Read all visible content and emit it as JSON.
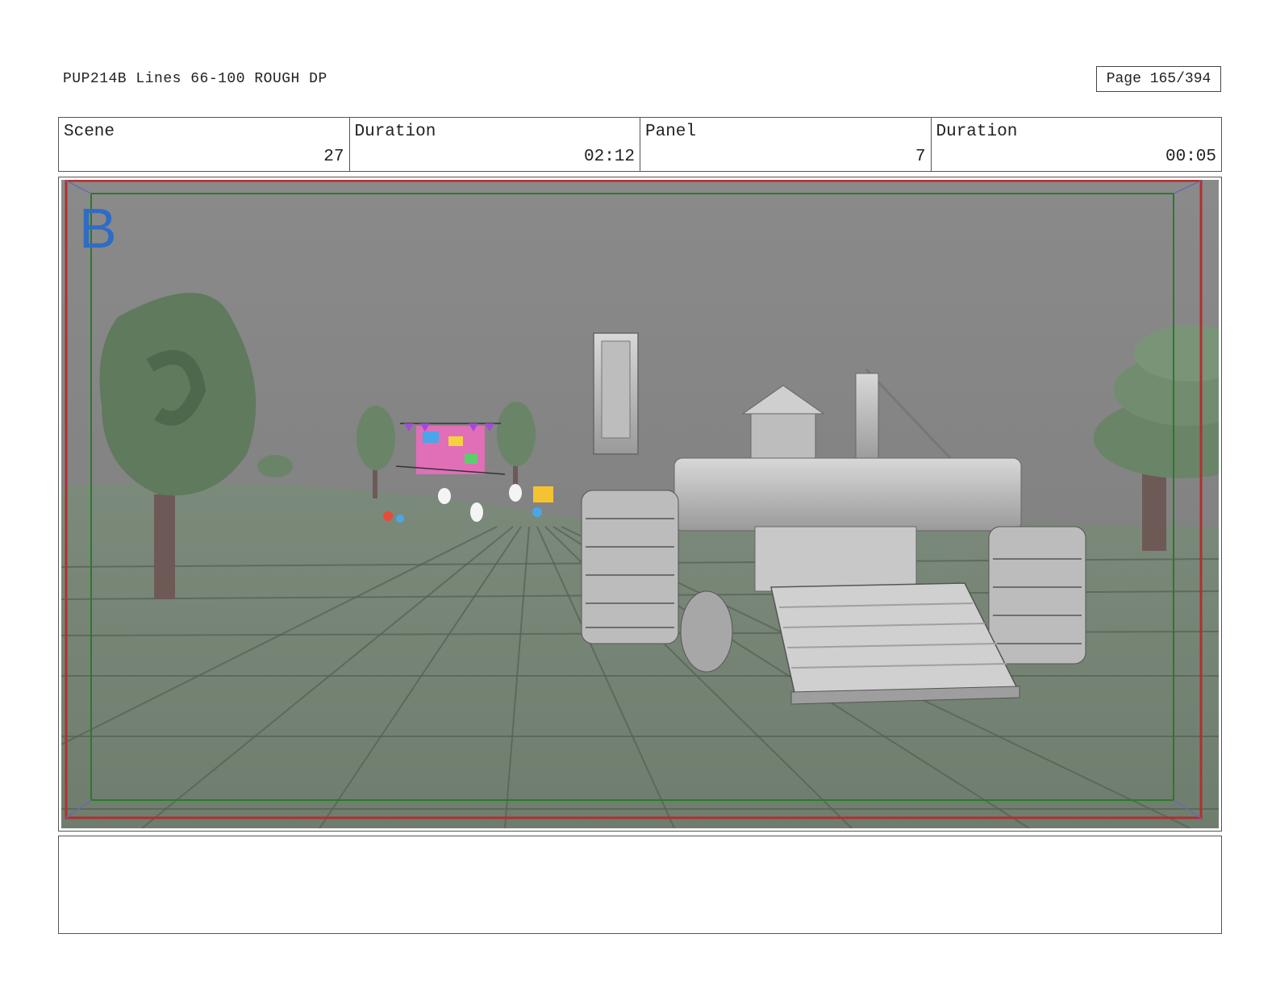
{
  "header": {
    "title": "PUP214B Lines 66-100 ROUGH DP",
    "page": "Page 165/394"
  },
  "info": {
    "scene_label": "Scene",
    "scene_value": "27",
    "scene_duration_label": "Duration",
    "scene_duration_value": "02:12",
    "panel_label": "Panel",
    "panel_value": "7",
    "panel_duration_label": "Duration",
    "panel_duration_value": "00:05"
  },
  "panel": {
    "letter": "B"
  },
  "notes": {
    "text": ""
  }
}
